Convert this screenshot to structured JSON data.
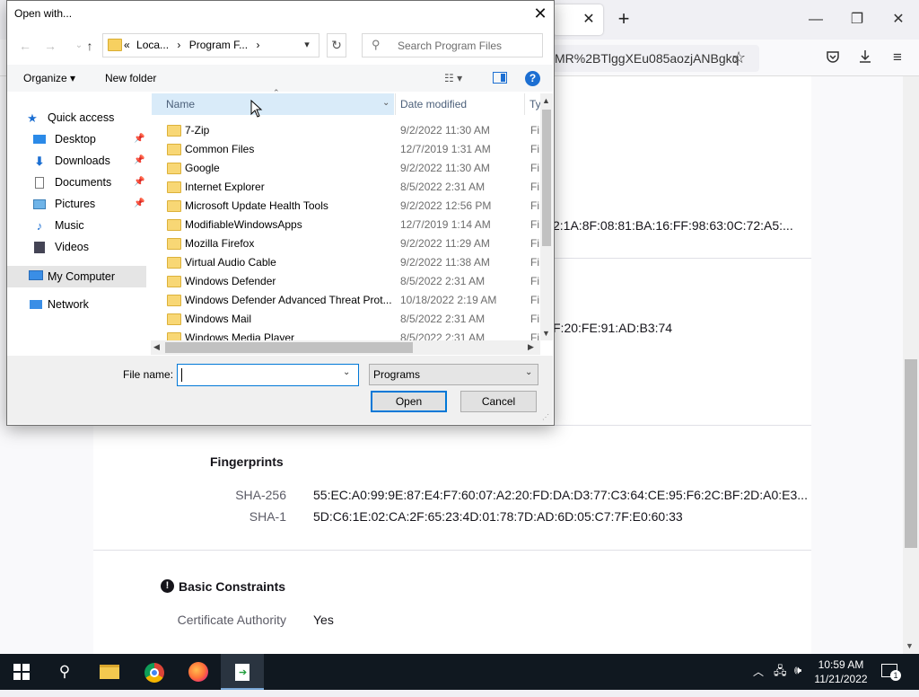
{
  "browser": {
    "url_fragment": "MR%2BTlggXEu085aozjANBgkq",
    "certificate": {
      "partial_line_1": "2:1A:8F:08:81:BA:16:FF:98:63:0C:72:A5:...",
      "partial_line_2": "F:20:FE:91:AD:B3:74",
      "fingerprints_title": "Fingerprints",
      "sha256_label": "SHA-256",
      "sha256_value": "55:EC:A0:99:9E:87:E4:F7:60:07:A2:20:FD:DA:D3:77:C3:64:CE:95:F6:2C:BF:2D:A0:E3...",
      "sha1_label": "SHA-1",
      "sha1_value": "5D:C6:1E:02:CA:2F:65:23:4D:01:78:7D:AD:6D:05:C7:7F:E0:60:33",
      "basic_constraints_title": "Basic Constraints",
      "ca_label": "Certificate Authority",
      "ca_value": "Yes"
    }
  },
  "dialog": {
    "title": "Open with...",
    "address": {
      "crumb_prefix": "«",
      "crumb_1": "Loca...",
      "sep": "›",
      "crumb_2": "Program F...",
      "sep_end": "›"
    },
    "search_placeholder": "Search Program Files",
    "toolbar": {
      "organize": "Organize ▾",
      "new_folder": "New folder"
    },
    "nav": {
      "quick_access": "Quick access",
      "desktop": "Desktop",
      "downloads": "Downloads",
      "documents": "Documents",
      "pictures": "Pictures",
      "music": "Music",
      "videos": "Videos",
      "my_computer": "My Computer",
      "network": "Network"
    },
    "columns": {
      "name": "Name",
      "date_modified": "Date modified",
      "type": "Ty"
    },
    "files": [
      {
        "name": "7-Zip",
        "date": "9/2/2022 11:30 AM",
        "type": "Fi"
      },
      {
        "name": "Common Files",
        "date": "12/7/2019 1:31 AM",
        "type": "Fi"
      },
      {
        "name": "Google",
        "date": "9/2/2022 11:30 AM",
        "type": "Fi"
      },
      {
        "name": "Internet Explorer",
        "date": "8/5/2022 2:31 AM",
        "type": "Fi"
      },
      {
        "name": "Microsoft Update Health Tools",
        "date": "9/2/2022 12:56 PM",
        "type": "Fi"
      },
      {
        "name": "ModifiableWindowsApps",
        "date": "12/7/2019 1:14 AM",
        "type": "Fi"
      },
      {
        "name": "Mozilla Firefox",
        "date": "9/2/2022 11:29 AM",
        "type": "Fi"
      },
      {
        "name": "Virtual Audio Cable",
        "date": "9/2/2022 11:38 AM",
        "type": "Fi"
      },
      {
        "name": "Windows Defender",
        "date": "8/5/2022 2:31 AM",
        "type": "Fi"
      },
      {
        "name": "Windows Defender Advanced Threat Prot...",
        "date": "10/18/2022 2:19 AM",
        "type": "Fi"
      },
      {
        "name": "Windows Mail",
        "date": "8/5/2022 2:31 AM",
        "type": "Fi"
      },
      {
        "name": "Windows Media Player",
        "date": "8/5/2022 2:31 AM",
        "type": "Fi"
      }
    ],
    "file_name_label": "File name:",
    "file_name_value": "",
    "filter_value": "Programs",
    "open_label": "Open",
    "cancel_label": "Cancel"
  },
  "taskbar": {
    "time": "10:59 AM",
    "date": "11/21/2022",
    "notification_count": "1"
  }
}
